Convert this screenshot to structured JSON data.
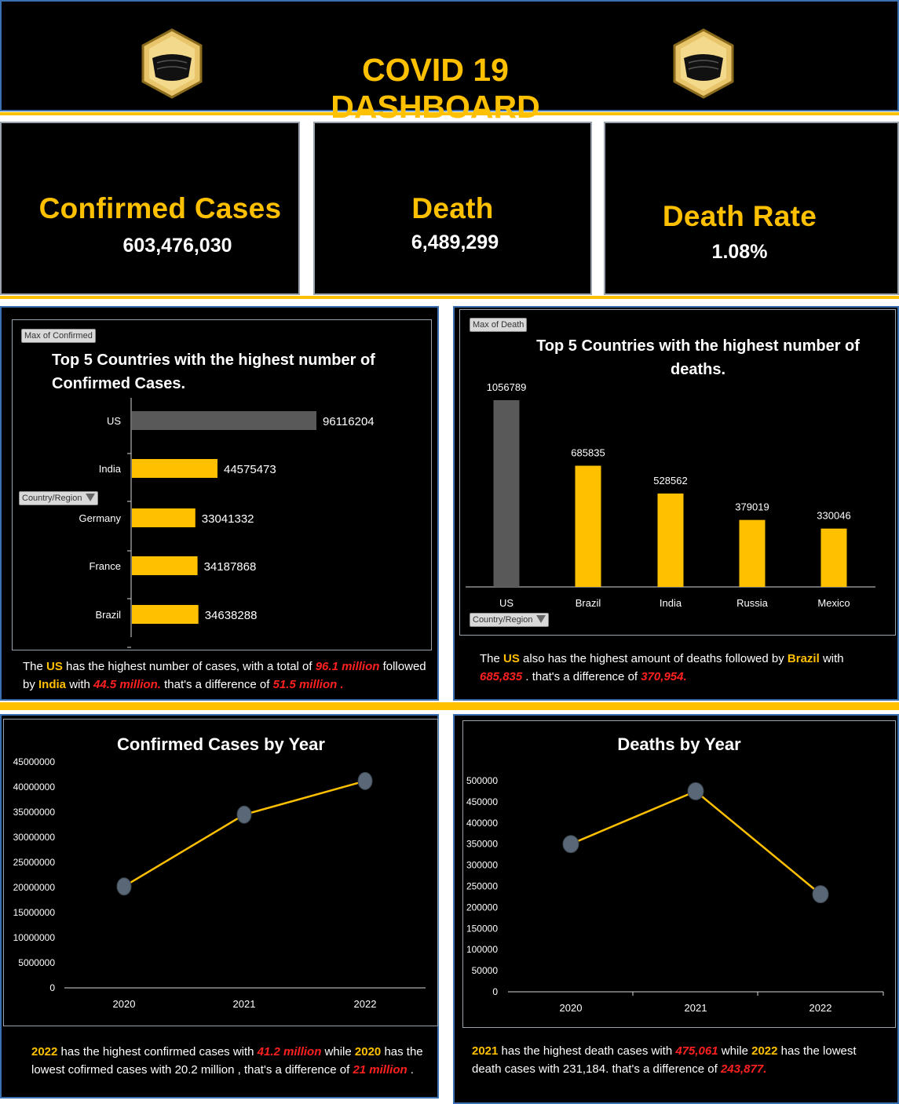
{
  "header": {
    "title": "COVID 19 DASHBOARD"
  },
  "kpis": [
    {
      "label": "Confirmed Cases",
      "value": "603,476,030"
    },
    {
      "label": "Death",
      "value": "6,489,299"
    },
    {
      "label": "Death Rate",
      "value": "1.08%"
    }
  ],
  "colors": {
    "accent": "#ffc000",
    "highlight_bar": "#595959",
    "emphasis_text": "#ff2020",
    "background": "#000000"
  },
  "confirmed_top5": {
    "field_button": "Max of Confirmed",
    "filter_button": "Country/Region",
    "title_line1": "Top 5 Countries  with the highest number  of",
    "title_line2": "Confirmed  Cases.",
    "note": {
      "p1": "The ",
      "b1": "US",
      "p2": " has the  highest number  of cases, with a total of ",
      "r1": "96.1  million",
      "p3": " followed",
      "p4": "by ",
      "b2": "India",
      "p5": " with  ",
      "r2": "44.5 million.",
      "p6": " that's a difference of ",
      "r3": "51.5  million ."
    }
  },
  "deaths_top5": {
    "field_button": "Max of Death",
    "filter_button": "Country/Region",
    "title_line1": "Top 5 Countries  with the highest number  of",
    "title_line2": "deaths.",
    "note": {
      "p1": "The ",
      "b1": "US",
      "p2": " also has the highest amount of deaths followed by ",
      "b2": "Brazil",
      "p3": " with",
      "r1": "685,835",
      "p4": " . that's a difference of  ",
      "r2": "370,954."
    }
  },
  "confirmed_by_year": {
    "title": "Confirmed Cases by Year",
    "note": {
      "b1": "2022",
      "p1": " has the highest confirmed  cases with ",
      "r1": "41.2 million",
      "p2": " while ",
      "b2": "2020",
      "p3": " has the",
      "p4": "lowest cofirmed cases with 20.2 million , that's a difference of ",
      "r2": "21 million",
      "p5": " ."
    }
  },
  "deaths_by_year": {
    "title": "Deaths by Year",
    "note": {
      "b1": "2021",
      "p1": " has the highest death cases with ",
      "r1": "475,061",
      "p2": " while ",
      "b2": "2022",
      "p3": " has the  lowest",
      "p4": "death cases with 231,184. that's a difference of ",
      "r2": "243,877."
    }
  },
  "chart_data": [
    {
      "type": "bar",
      "orientation": "horizontal",
      "title": "Top 5 Countries  with the highest number  of Confirmed  Cases.",
      "categories": [
        "US",
        "India",
        "Germany",
        "France",
        "Brazil"
      ],
      "values": [
        96116204,
        44575473,
        33041332,
        34187868,
        34638288
      ],
      "value_labels": [
        "96116204",
        "44575473",
        "33041332",
        "34187868",
        "34638288"
      ],
      "highlight_index": 0,
      "grid": false,
      "legend": "none"
    },
    {
      "type": "bar",
      "orientation": "vertical",
      "title": "Top 5 Countries  with the highest number  of deaths.",
      "categories": [
        "US",
        "Brazil",
        "India",
        "Russia",
        "Mexico"
      ],
      "values": [
        1056789,
        685835,
        528562,
        379019,
        330046
      ],
      "value_labels": [
        "1056789",
        "685835",
        "528562",
        "379019",
        "330046"
      ],
      "highlight_index": 0,
      "grid": false,
      "legend": "none"
    },
    {
      "type": "line",
      "title": "Confirmed Cases by Year",
      "x": [
        "2020",
        "2021",
        "2022"
      ],
      "values": [
        20200000,
        34500000,
        41200000
      ],
      "ylim": [
        0,
        45000000
      ],
      "yticks": [
        "0",
        "5000000",
        "10000000",
        "15000000",
        "20000000",
        "25000000",
        "30000000",
        "35000000",
        "40000000",
        "45000000"
      ],
      "grid": false,
      "legend": "none"
    },
    {
      "type": "line",
      "title": "Deaths by Year",
      "x": [
        "2020",
        "2021",
        "2022"
      ],
      "values": [
        350000,
        475061,
        231184
      ],
      "ylim": [
        0,
        500000
      ],
      "yticks": [
        "0",
        "50000",
        "100000",
        "150000",
        "200000",
        "250000",
        "300000",
        "350000",
        "400000",
        "450000",
        "500000"
      ],
      "grid": false,
      "legend": "none"
    }
  ]
}
